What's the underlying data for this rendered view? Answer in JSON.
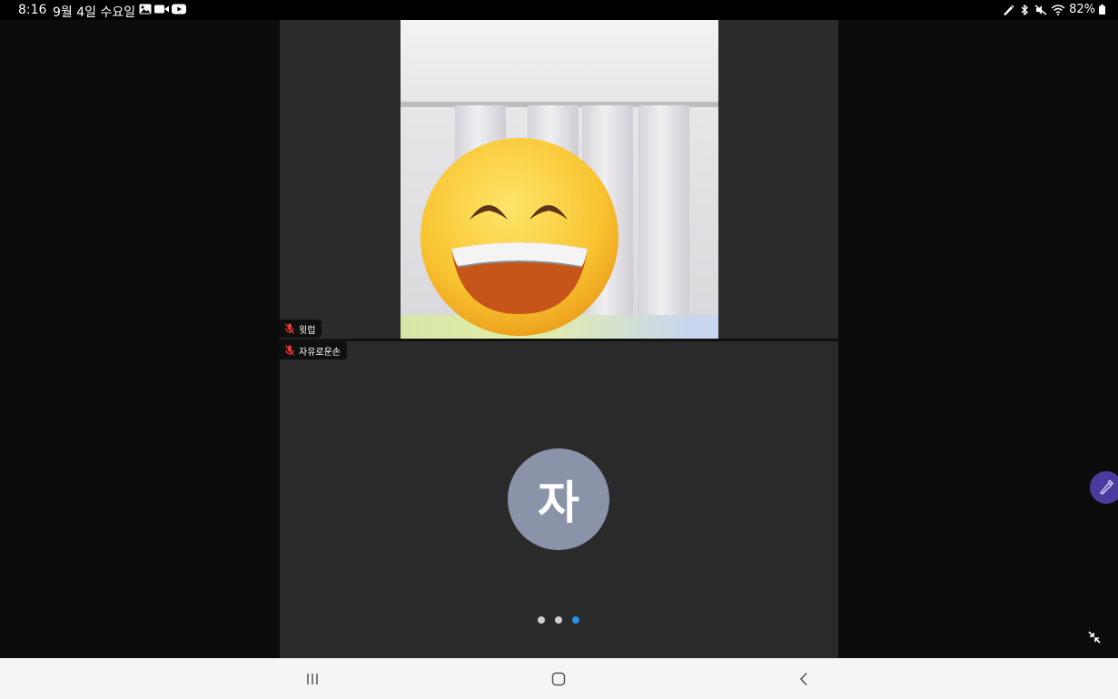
{
  "status_bar": {
    "time": "8:16",
    "date": "9월 4일 수요일",
    "notifications": [
      "image-icon",
      "video-camera-icon",
      "youtube-icon"
    ],
    "system_icons": [
      "stylus-icon",
      "bluetooth-icon",
      "mute-icon",
      "wifi-icon"
    ],
    "battery": "82%"
  },
  "call": {
    "participants": [
      {
        "name": "윗럽",
        "muted": true
      },
      {
        "name": "자유로운손",
        "muted": true,
        "avatar_initial": "자",
        "avatar_color": "#8b93a8"
      }
    ],
    "page_indicator": {
      "count": 3,
      "active": 3,
      "active_color": "#2a8ee8"
    }
  },
  "floating": {
    "pen_button_color": "#4a3b9e"
  },
  "nav_bar": {
    "buttons": [
      "recent-apps-icon",
      "home-icon",
      "back-icon"
    ]
  }
}
